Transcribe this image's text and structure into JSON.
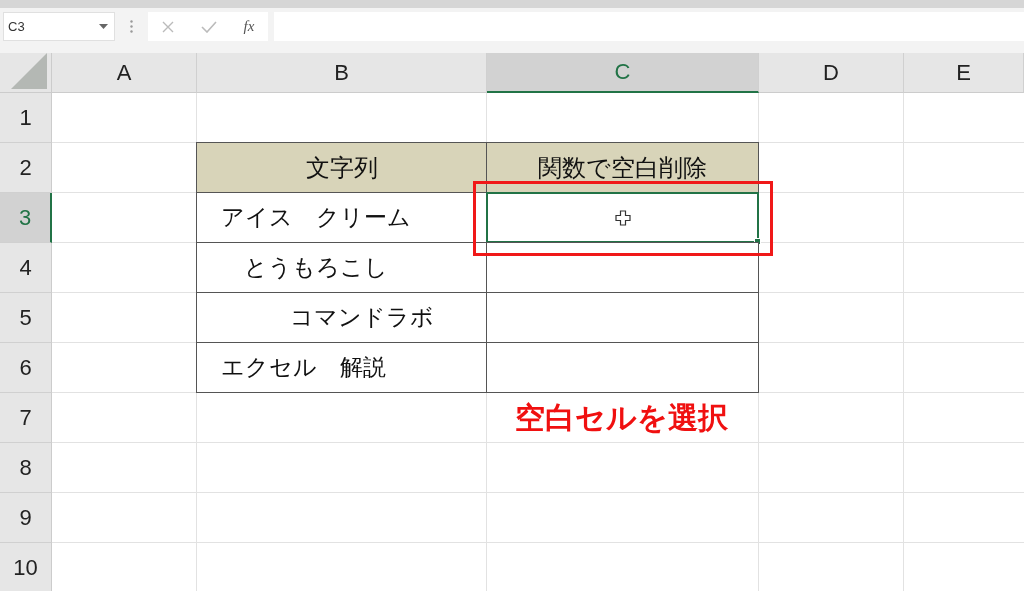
{
  "formula_bar": {
    "name_box": "C3",
    "function_label": "fx"
  },
  "columns": [
    {
      "label": "A",
      "selected": false
    },
    {
      "label": "B",
      "selected": false
    },
    {
      "label": "C",
      "selected": true
    },
    {
      "label": "D",
      "selected": false
    },
    {
      "label": "E",
      "selected": false
    }
  ],
  "rows": [
    {
      "label": "1",
      "selected": false
    },
    {
      "label": "2",
      "selected": false
    },
    {
      "label": "3",
      "selected": true
    },
    {
      "label": "4",
      "selected": false
    },
    {
      "label": "5",
      "selected": false
    },
    {
      "label": "6",
      "selected": false
    },
    {
      "label": "7",
      "selected": false
    },
    {
      "label": "8",
      "selected": false
    },
    {
      "label": "9",
      "selected": false
    },
    {
      "label": "10",
      "selected": false
    }
  ],
  "table": {
    "headers": [
      "文字列",
      "関数で空白削除"
    ],
    "rows": [
      {
        "value": "アイス　クリーム",
        "result_selected": true
      },
      {
        "value": "　とうもろこし",
        "result_selected": false
      },
      {
        "value": "　　　コマンドラボ",
        "result_selected": false
      },
      {
        "value": "エクセル　解説",
        "result_selected": false
      }
    ]
  },
  "annotation": "空白セルを選択"
}
